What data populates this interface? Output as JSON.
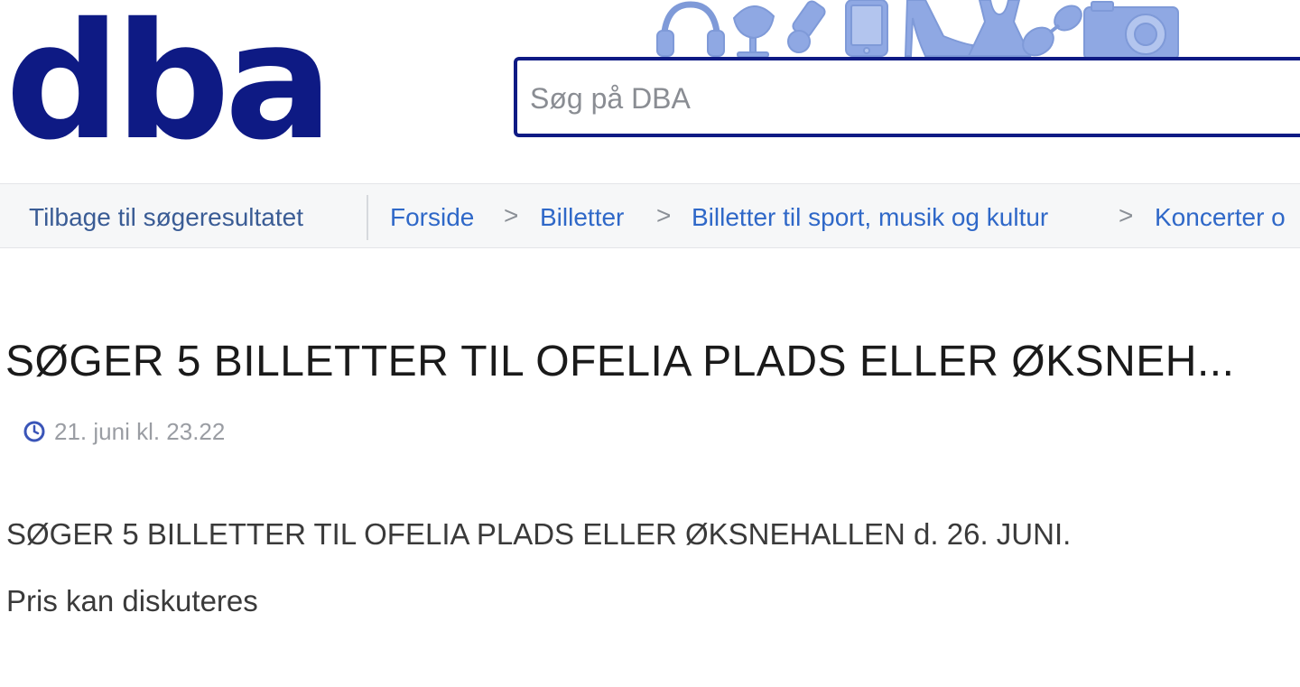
{
  "header": {
    "logo_text": "dba",
    "brand_color": "#0e1a84",
    "search_placeholder": "Søg på DBA",
    "decorative_icons": [
      "headphones-icon",
      "chair-icon",
      "watch-icon",
      "phone-icon",
      "shoe-icon",
      "dress-icon",
      "sunglasses-icon",
      "camera-icon"
    ]
  },
  "breadcrumb": {
    "back_label": "Tilbage til søgeresultatet",
    "items": [
      {
        "label": "Forside"
      },
      {
        "label": "Billetter"
      },
      {
        "label": "Billetter til sport, musik og kultur"
      },
      {
        "label": "Koncerter o"
      }
    ],
    "separator": ">",
    "link_color": "#2f68c8"
  },
  "ad": {
    "title": "SØGER 5 BILLETTER TIL OFELIA PLADS ELLER ØKSNEH...",
    "date": "21. juni kl. 23.22",
    "description_lines": [
      "SØGER 5 BILLETTER TIL OFELIA PLADS ELLER ØKSNEHALLEN d. 26. JUNI.",
      "Pris kan diskuteres"
    ]
  }
}
